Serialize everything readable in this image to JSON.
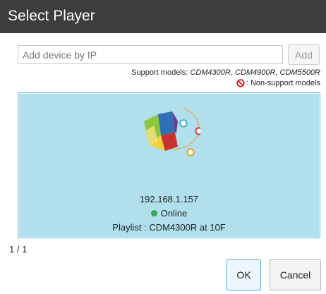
{
  "window": {
    "title": "Select Player"
  },
  "add_device": {
    "placeholder": "Add device by IP",
    "value": "Add device by IP",
    "add_label": "Add"
  },
  "support": {
    "prefix": "Support models: ",
    "models": "CDM4300R, CDM4900R, CDM5500R",
    "non_support_label": ": Non-support models",
    "non_support_icon": "prohibited-icon"
  },
  "devices": [
    {
      "ip": "192.168.1.157",
      "status": "Online",
      "status_color": "#35a853",
      "playlist": "Playlist : CDM4300R at 10F",
      "icon": "player-logo-icon"
    }
  ],
  "pagination": {
    "text": "1 / 1"
  },
  "buttons": {
    "ok_label": "OK",
    "cancel_label": "Cancel"
  },
  "colors": {
    "titlebar": "#3d3d3d",
    "card_bg": "#b1dfec",
    "card_border": "#6ec0dd",
    "ok_border": "#5aaee8"
  }
}
